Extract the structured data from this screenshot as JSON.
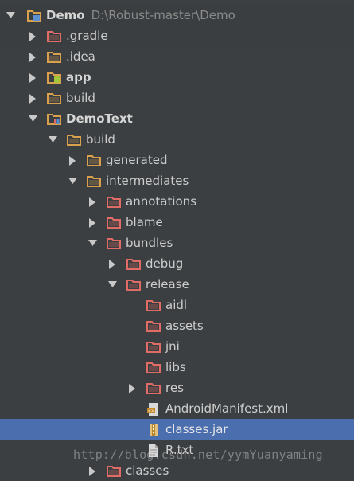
{
  "tree": [
    {
      "label": "Demo",
      "path": "D:\\Robust-master\\Demo",
      "icon": "project-folder-icon",
      "arrow": "expanded",
      "bold": true
    },
    {
      "label": ".gradle",
      "icon": "excluded-folder-icon",
      "arrow": "collapsed"
    },
    {
      "label": ".idea",
      "icon": "folder-icon",
      "arrow": "collapsed"
    },
    {
      "label": "app",
      "icon": "android-module-icon",
      "arrow": "collapsed",
      "bold": true
    },
    {
      "label": "build",
      "icon": "folder-icon",
      "arrow": "collapsed"
    },
    {
      "label": "DemoText",
      "icon": "module-folder-icon",
      "arrow": "expanded",
      "bold": true
    },
    {
      "label": "build",
      "icon": "folder-icon",
      "arrow": "expanded"
    },
    {
      "label": "generated",
      "icon": "folder-icon",
      "arrow": "collapsed"
    },
    {
      "label": "intermediates",
      "icon": "folder-icon",
      "arrow": "expanded"
    },
    {
      "label": "annotations",
      "icon": "excluded-folder-icon",
      "arrow": "collapsed"
    },
    {
      "label": "blame",
      "icon": "excluded-folder-icon",
      "arrow": "collapsed"
    },
    {
      "label": "bundles",
      "icon": "excluded-folder-icon",
      "arrow": "expanded"
    },
    {
      "label": "debug",
      "icon": "excluded-folder-icon",
      "arrow": "collapsed"
    },
    {
      "label": "release",
      "icon": "excluded-folder-icon",
      "arrow": "expanded"
    },
    {
      "label": "aidl",
      "icon": "excluded-folder-icon",
      "arrow": "none"
    },
    {
      "label": "assets",
      "icon": "excluded-folder-icon",
      "arrow": "none"
    },
    {
      "label": "jni",
      "icon": "excluded-folder-icon",
      "arrow": "none"
    },
    {
      "label": "libs",
      "icon": "excluded-folder-icon",
      "arrow": "none"
    },
    {
      "label": "res",
      "icon": "excluded-folder-icon",
      "arrow": "collapsed"
    },
    {
      "label": "AndroidManifest.xml",
      "icon": "xml-file-icon",
      "arrow": "none"
    },
    {
      "label": "classes.jar",
      "icon": "jar-file-icon",
      "arrow": "none",
      "selected": true
    },
    {
      "label": "R.txt",
      "icon": "text-file-icon",
      "arrow": "none"
    },
    {
      "label": "classes",
      "icon": "excluded-folder-icon",
      "arrow": "collapsed"
    }
  ],
  "watermark": "http://blog.csdn.net/yymYuanyaming",
  "colors": {
    "background": "#3c3f41",
    "selection": "#4b6eaf",
    "folder": "#d9a14c",
    "excluded_folder": "#e06c65"
  }
}
